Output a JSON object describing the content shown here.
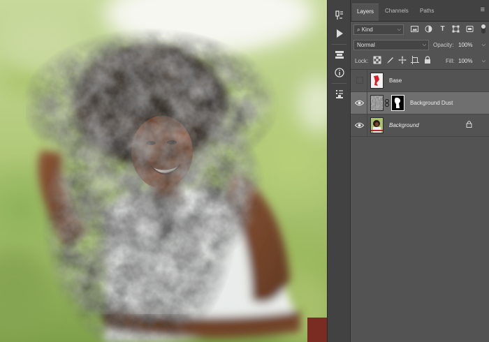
{
  "colors": {
    "panel_bg": "#535353",
    "tab_bar": "#424242",
    "selected_row": "#6f6f6f",
    "sky": "#f4f6ee"
  },
  "toolstrip": {
    "icons": [
      "history-brush-icon",
      "play-icon",
      "layer-comps-icon",
      "info-icon",
      "stamp-icon"
    ]
  },
  "panel": {
    "tabs": [
      {
        "label": "Layers",
        "active": true
      },
      {
        "label": "Channels",
        "active": false
      },
      {
        "label": "Paths",
        "active": false
      }
    ],
    "filter": {
      "kind_label": "Kind",
      "search_glyph": "⌕",
      "icons": [
        "image-filter-icon",
        "adjustment-filter-icon",
        "type-filter-icon",
        "shape-filter-icon",
        "smart-object-filter-icon"
      ],
      "type_glyph": "T"
    },
    "blend_mode": "Normal",
    "opacity_label": "Opacity:",
    "opacity_value": "100%",
    "lock_label": "Lock:",
    "fill_label": "Fill:",
    "fill_value": "100%",
    "layers": [
      {
        "name": "Base",
        "visible": false,
        "selected": false,
        "italic": false,
        "has_mask": false,
        "locked": false
      },
      {
        "name": "Background Dust",
        "visible": true,
        "selected": true,
        "italic": false,
        "has_mask": true,
        "locked": false
      },
      {
        "name": "Background",
        "visible": true,
        "selected": false,
        "italic": true,
        "has_mask": false,
        "locked": true
      }
    ]
  }
}
